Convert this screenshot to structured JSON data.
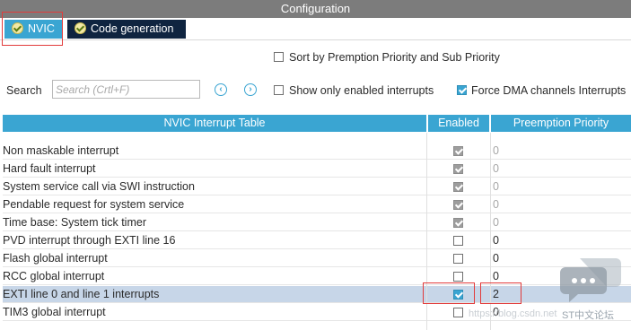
{
  "window": {
    "title": "Configuration"
  },
  "tabs": [
    {
      "label": "NVIC",
      "active": true
    },
    {
      "label": "Code generation",
      "active": false
    }
  ],
  "options": {
    "sort_by_priority": {
      "label": "Sort by Premption Priority and Sub Priority",
      "checked": false
    },
    "show_only_enabled": {
      "label": "Show only enabled interrupts",
      "checked": false
    },
    "force_dma": {
      "label": "Force DMA channels Interrupts",
      "checked": true
    }
  },
  "search": {
    "label": "Search",
    "placeholder": "Search (Crtl+F)",
    "value": ""
  },
  "table": {
    "headers": [
      "NVIC Interrupt Table",
      "Enabled",
      "Preemption Priority"
    ],
    "rows": [
      {
        "name": "Non maskable interrupt",
        "enabled": true,
        "locked": true,
        "priority": "0"
      },
      {
        "name": "Hard fault interrupt",
        "enabled": true,
        "locked": true,
        "priority": "0"
      },
      {
        "name": "System service call via SWI instruction",
        "enabled": true,
        "locked": true,
        "priority": "0"
      },
      {
        "name": "Pendable request for system service",
        "enabled": true,
        "locked": true,
        "priority": "0"
      },
      {
        "name": "Time base: System tick timer",
        "enabled": true,
        "locked": true,
        "priority": "0"
      },
      {
        "name": "PVD interrupt through EXTI line 16",
        "enabled": false,
        "locked": false,
        "priority": "0"
      },
      {
        "name": "Flash global interrupt",
        "enabled": false,
        "locked": false,
        "priority": "0"
      },
      {
        "name": "RCC global interrupt",
        "enabled": false,
        "locked": false,
        "priority": "0"
      },
      {
        "name": "EXTI line 0 and line 1 interrupts",
        "enabled": true,
        "locked": false,
        "priority": "2",
        "selected": true
      },
      {
        "name": "TIM3 global interrupt",
        "enabled": false,
        "locked": false,
        "priority": "0"
      }
    ]
  },
  "watermark": {
    "text": "ST中文论坛",
    "url": "https://blog.csdn.net"
  },
  "colors": {
    "accent": "#3aa5d2",
    "dark_tab": "#0f2440",
    "title_bar": "#7c7c7c",
    "selected_row": "#c7d6e8",
    "highlight": "#e23b3b"
  }
}
